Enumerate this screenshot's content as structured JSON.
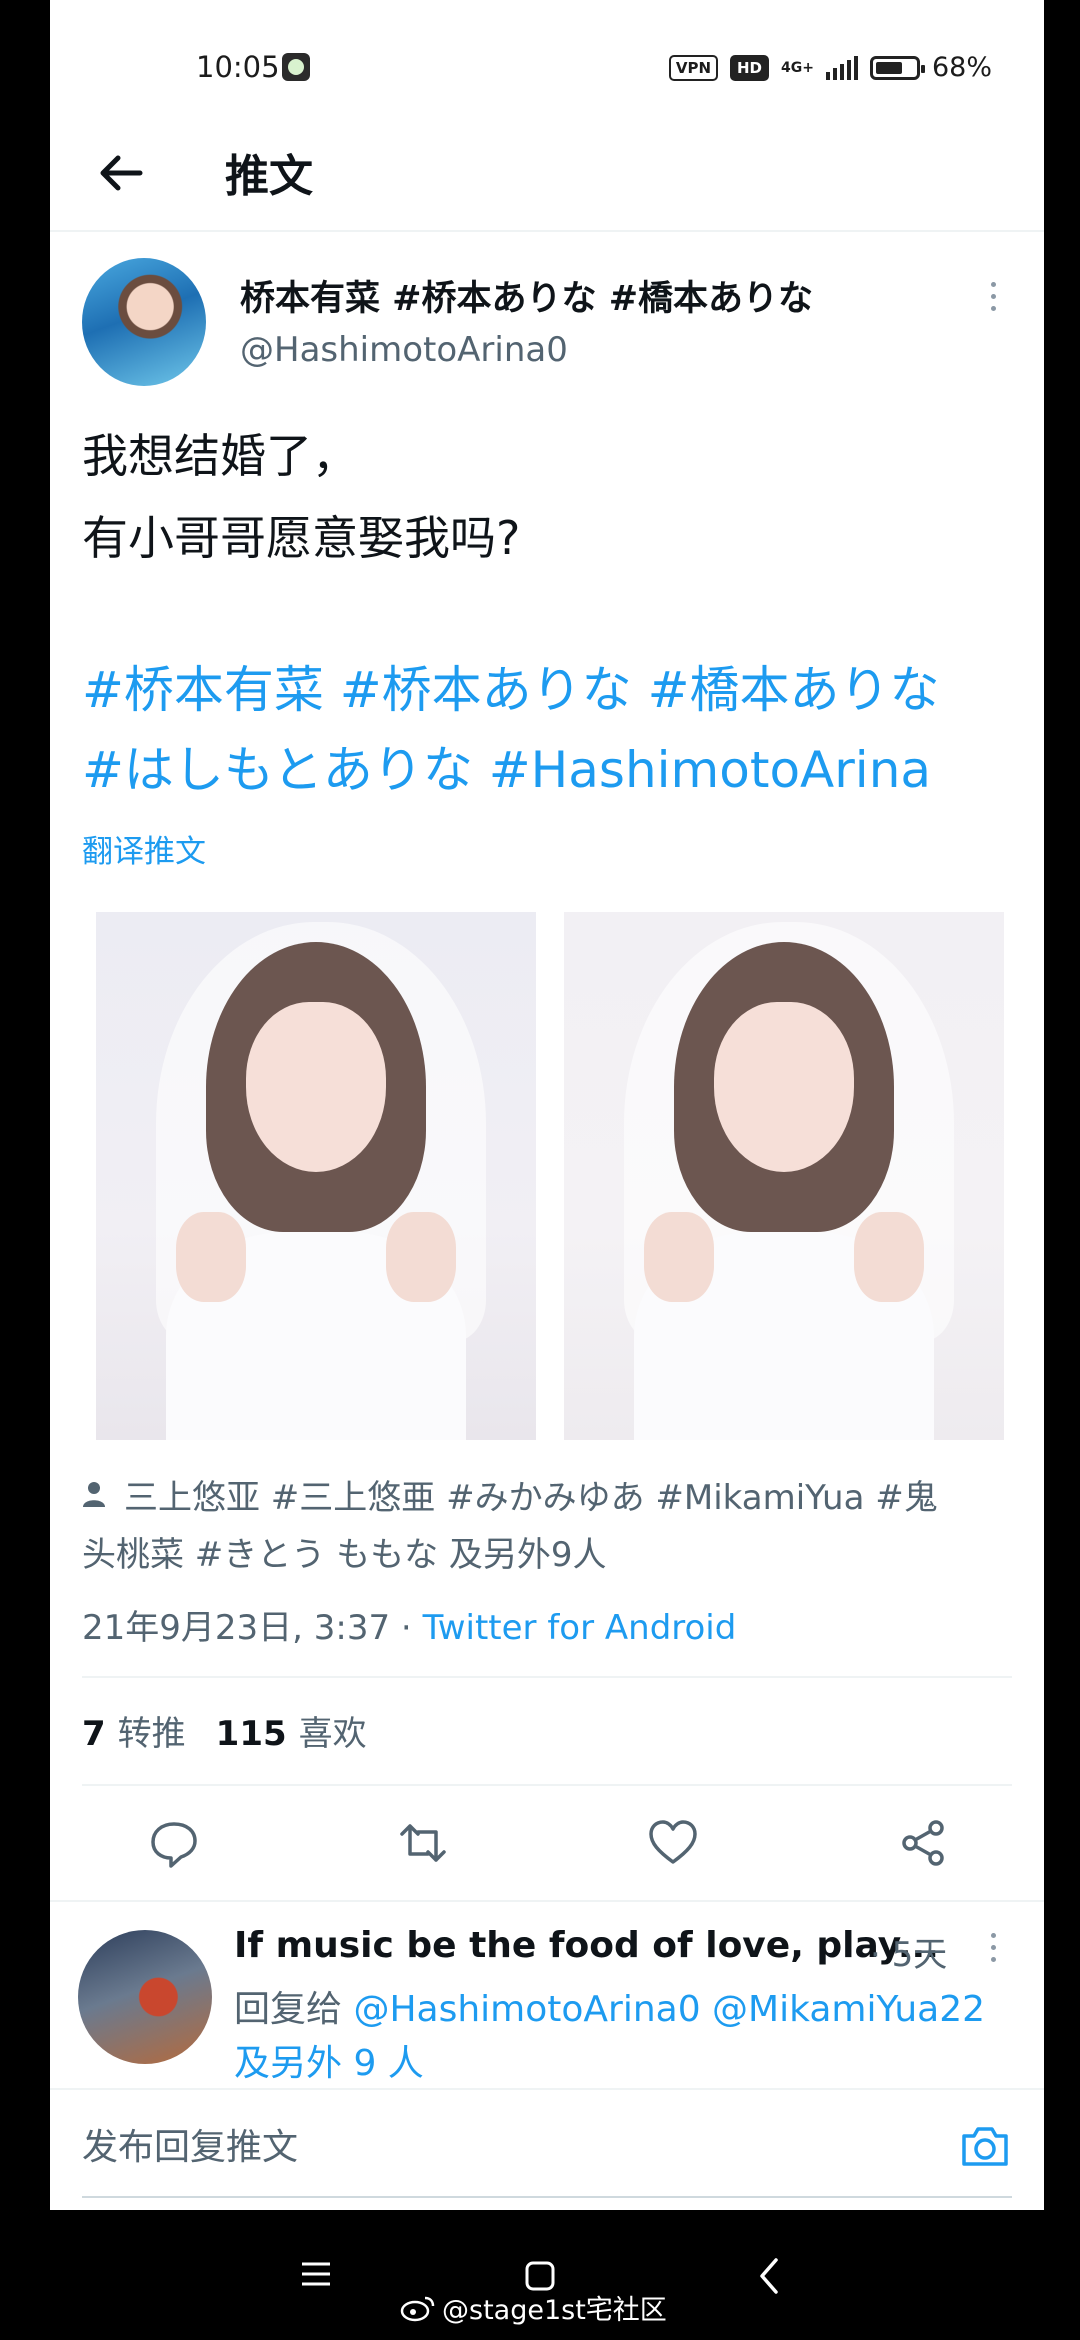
{
  "status_bar": {
    "time": "10:05",
    "vpn": "VPN",
    "hd": "HD",
    "network": "4G+",
    "battery_pct": "68%",
    "battery_level": 0.68
  },
  "header": {
    "title": "推文",
    "back_icon": "arrow-left-icon"
  },
  "tweet": {
    "author_name": "桥本有菜 #桥本ありな #橋本ありな",
    "author_handle": "@HashimotoArina0",
    "body_lines": [
      "我想结婚了，",
      "有小哥哥愿意娶我吗?"
    ],
    "hashtag_lines": [
      "#桥本有菜 #桥本ありな #橋本ありな",
      "#はしもとありな #HashimotoArina"
    ],
    "translate_label": "翻译推文",
    "tagged_lines": [
      "三上悠亚 #三上悠亜 #みかみゆあ #MikamiYua #鬼",
      "头桃菜 #きとう ももな 及另外9人"
    ],
    "date": "21年9月23日, 3:37 · ",
    "source": "Twitter for Android",
    "retweet_count": "7",
    "retweet_label": "转推",
    "like_count": "115",
    "like_label": "喜欢"
  },
  "reply": {
    "title": "If music be the food of love, play...",
    "time": "· 5天",
    "prefix": "回复给 ",
    "mentions": "@HashimotoArina0 @MikamiYua22",
    "others": "及另外 9 人"
  },
  "compose": {
    "placeholder": "发布回复推文"
  },
  "watermark": {
    "text": "@stage1st宅社区"
  },
  "colors": {
    "accent": "#1d9bf0",
    "text": "#0f1419",
    "muted": "#536471"
  }
}
